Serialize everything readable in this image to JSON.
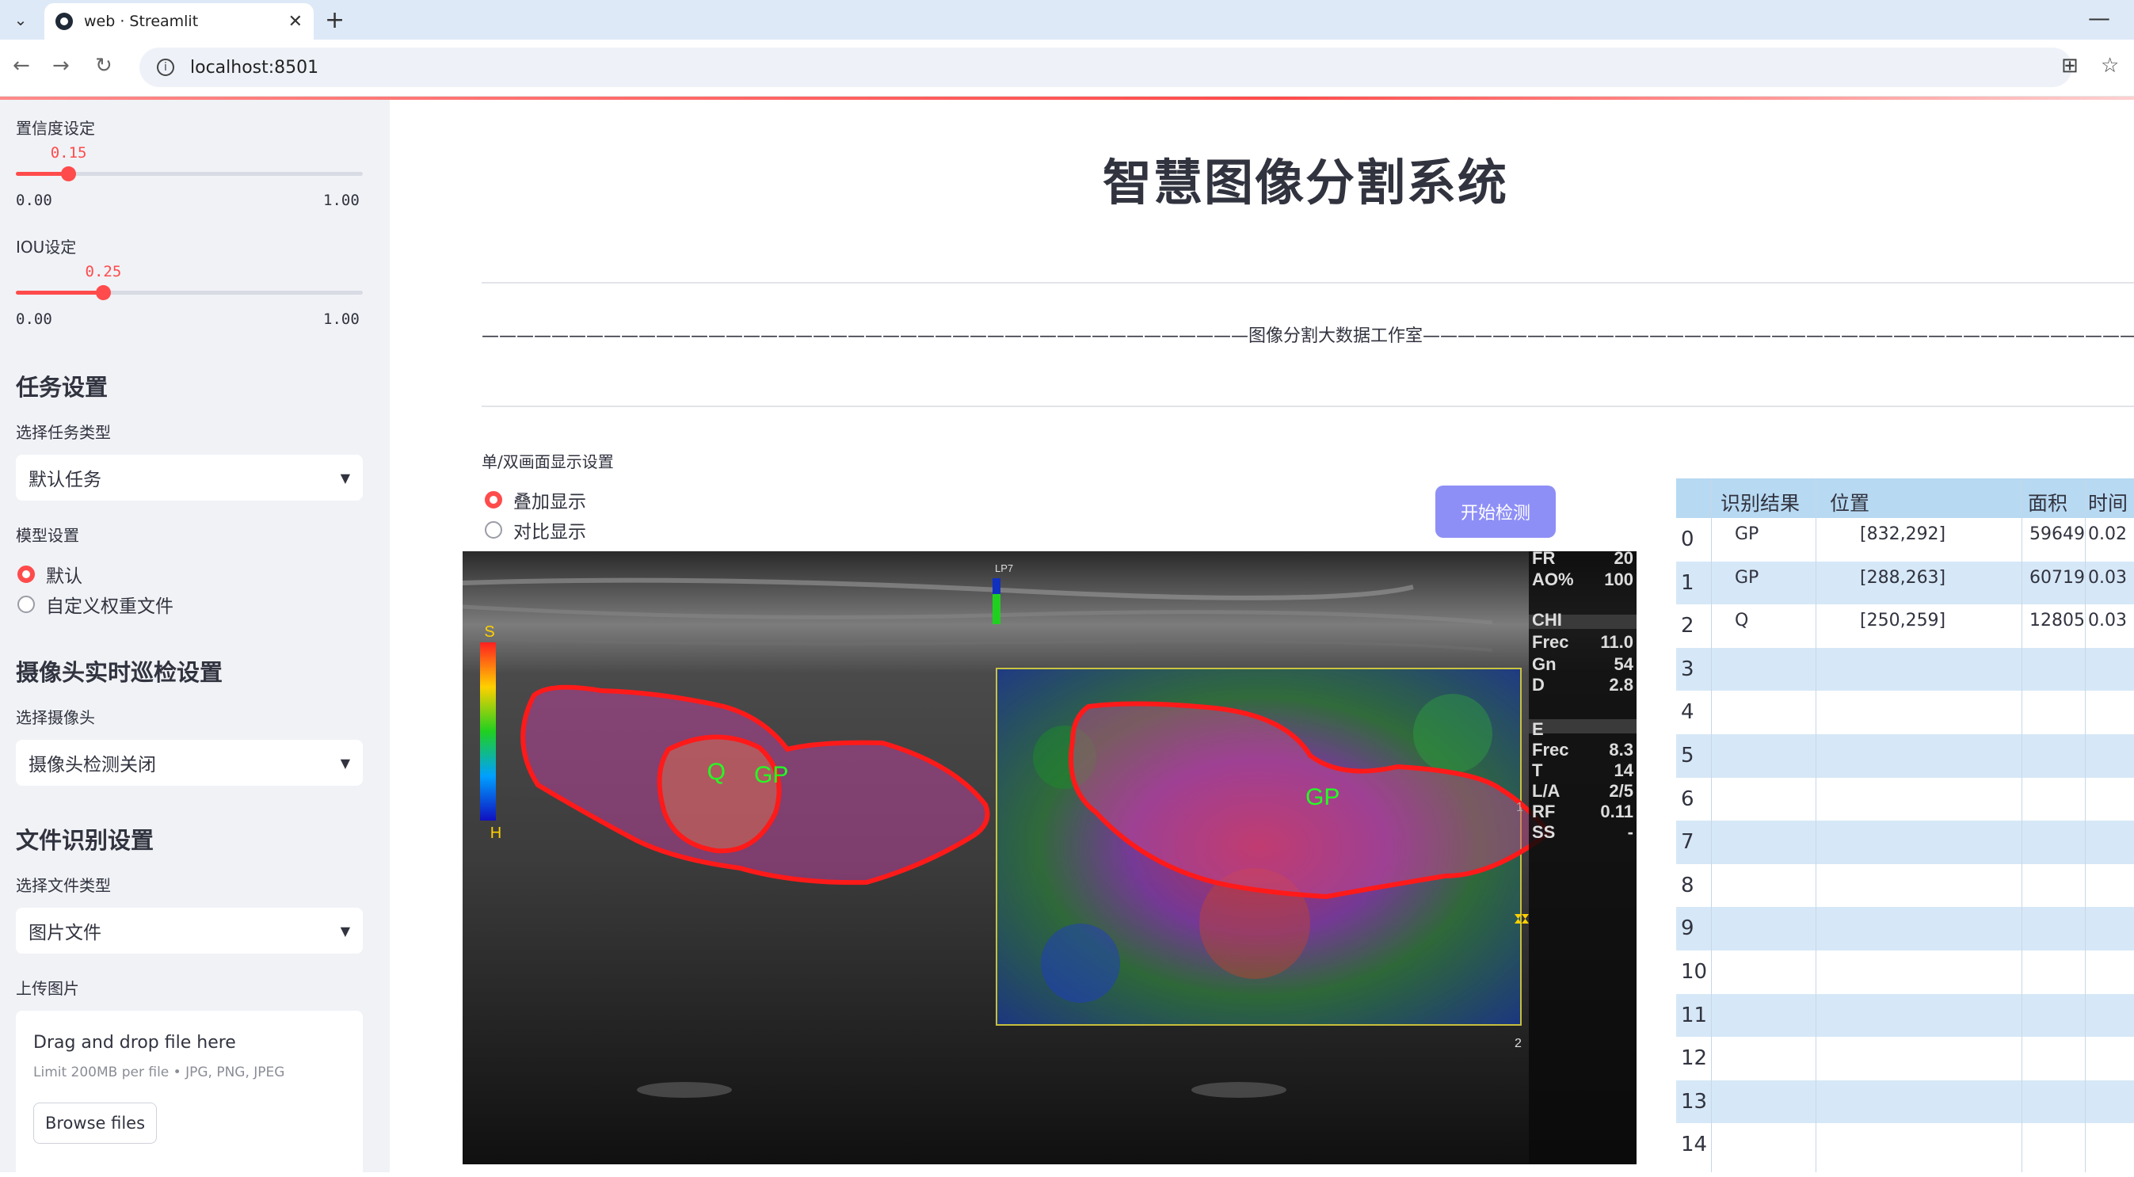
{
  "browser": {
    "tab_title": "web · Streamlit",
    "url": "localhost:8501"
  },
  "sidebar": {
    "confidence": {
      "label": "置信度设定",
      "value": "0.15",
      "value_num": 0.15,
      "min": "0.00",
      "max": "1.00"
    },
    "iou": {
      "label": "IOU设定",
      "value": "0.25",
      "value_num": 0.25,
      "min": "0.00",
      "max": "1.00"
    },
    "task_heading": "任务设置",
    "task_type_label": "选择任务类型",
    "task_type_value": "默认任务",
    "model_label": "模型设置",
    "model_options": [
      "默认",
      "自定义权重文件"
    ],
    "model_selected": 0,
    "camera_heading": "摄像头实时巡检设置",
    "camera_label": "选择摄像头",
    "camera_value": "摄像头检测关闭",
    "file_heading": "文件识别设置",
    "file_type_label": "选择文件类型",
    "file_type_value": "图片文件",
    "upload_label": "上传图片",
    "upload_title": "Drag and drop file here",
    "upload_sub": "Limit 200MB per file • JPG, PNG, JPEG",
    "browse_label": "Browse files"
  },
  "main": {
    "title": "智慧图像分割系统",
    "studio": "————————————————————————————————————————————图像分割大数据工作室——————————————————————————————————————————————",
    "display_label": "单/双画面显示设置",
    "display_options": [
      "叠加显示",
      "对比显示"
    ],
    "display_selected": 0,
    "start_button": "开始检测"
  },
  "ultrasound": {
    "left_labels": [
      "Q",
      "GP"
    ],
    "right_label": "GP",
    "scale_top": "S",
    "scale_bottom": "H",
    "probe": "LP7",
    "params": [
      [
        "FR",
        "20"
      ],
      [
        "AO%",
        "100"
      ],
      [
        "CHI",
        ""
      ],
      [
        "Frec",
        "11.0"
      ],
      [
        "Gn",
        "54"
      ],
      [
        "D",
        "2.8"
      ],
      [
        "E",
        ""
      ],
      [
        "Frec",
        "8.3"
      ],
      [
        "T",
        "14"
      ],
      [
        "L/A",
        "2/5"
      ],
      [
        "RF",
        "0.11"
      ],
      [
        "SS",
        "-"
      ]
    ],
    "depth_marks": [
      "1",
      "2"
    ]
  },
  "table": {
    "headers": [
      "识别结果",
      "位置",
      "面积",
      "时间"
    ],
    "rows": [
      {
        "index": "0",
        "result": "GP",
        "position": "[832,292]",
        "area": "59649",
        "time": "0.02"
      },
      {
        "index": "1",
        "result": "GP",
        "position": "[288,263]",
        "area": "60719",
        "time": "0.03"
      },
      {
        "index": "2",
        "result": "Q",
        "position": "[250,259]",
        "area": "12805",
        "time": "0.03"
      },
      {
        "index": "3",
        "result": "",
        "position": "",
        "area": "",
        "time": ""
      },
      {
        "index": "4",
        "result": "",
        "position": "",
        "area": "",
        "time": ""
      },
      {
        "index": "5",
        "result": "",
        "position": "",
        "area": "",
        "time": ""
      },
      {
        "index": "6",
        "result": "",
        "position": "",
        "area": "",
        "time": ""
      },
      {
        "index": "7",
        "result": "",
        "position": "",
        "area": "",
        "time": ""
      },
      {
        "index": "8",
        "result": "",
        "position": "",
        "area": "",
        "time": ""
      },
      {
        "index": "9",
        "result": "",
        "position": "",
        "area": "",
        "time": ""
      },
      {
        "index": "10",
        "result": "",
        "position": "",
        "area": "",
        "time": ""
      },
      {
        "index": "11",
        "result": "",
        "position": "",
        "area": "",
        "time": ""
      },
      {
        "index": "12",
        "result": "",
        "position": "",
        "area": "",
        "time": ""
      },
      {
        "index": "13",
        "result": "",
        "position": "",
        "area": "",
        "time": ""
      },
      {
        "index": "14",
        "result": "",
        "position": "",
        "area": "",
        "time": ""
      }
    ]
  },
  "colors": {
    "accent": "#ff4b4b",
    "button": "#8e8ff6",
    "sidebar_bg": "#f0f2f6",
    "table_header": "#b8d9f2",
    "table_alt": "#d6e8f7",
    "mask_outline": "#ff1a1a",
    "label_green": "#22ff22"
  }
}
